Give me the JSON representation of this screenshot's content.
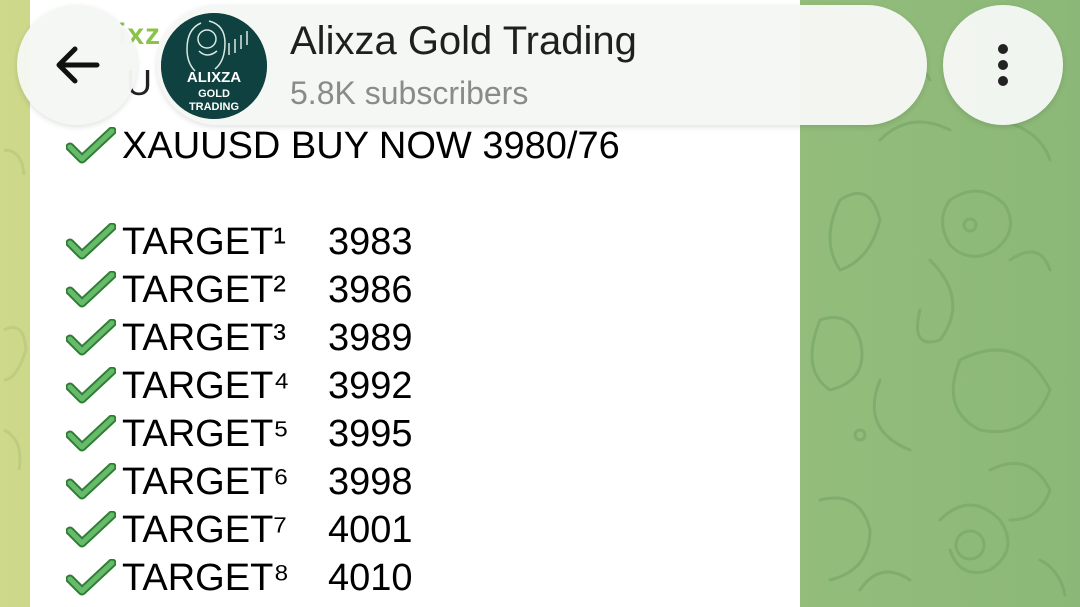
{
  "header": {
    "channel_name": "Alixza Gold Trading",
    "subscribers": "5.8K subscribers",
    "avatar_text": [
      "ALIXZA",
      "GOLD",
      "TRADING"
    ],
    "back_icon": "arrow-left-icon",
    "menu_icon": "more-vertical-icon"
  },
  "partial_previous": {
    "name_fragment": "ixz",
    "text_fragment": "U"
  },
  "message": {
    "headline": "XAUUSD BUY NOW 3980/76",
    "targets": [
      {
        "label": "TARGET¹",
        "value": "3983"
      },
      {
        "label": "TARGET²",
        "value": "3986"
      },
      {
        "label": "TARGET³",
        "value": "3989"
      },
      {
        "label": "TARGET⁴",
        "value": "3992"
      },
      {
        "label": "TARGET⁵",
        "value": "3995"
      },
      {
        "label": "TARGET⁶",
        "value": "3998"
      },
      {
        "label": "TARGET⁷",
        "value": "4001"
      },
      {
        "label": "TARGET⁸",
        "value": "4010"
      }
    ]
  },
  "colors": {
    "check_green": "#4caf50",
    "wallpaper_green": "#8bb878",
    "accent_name": "#8bc34a"
  }
}
